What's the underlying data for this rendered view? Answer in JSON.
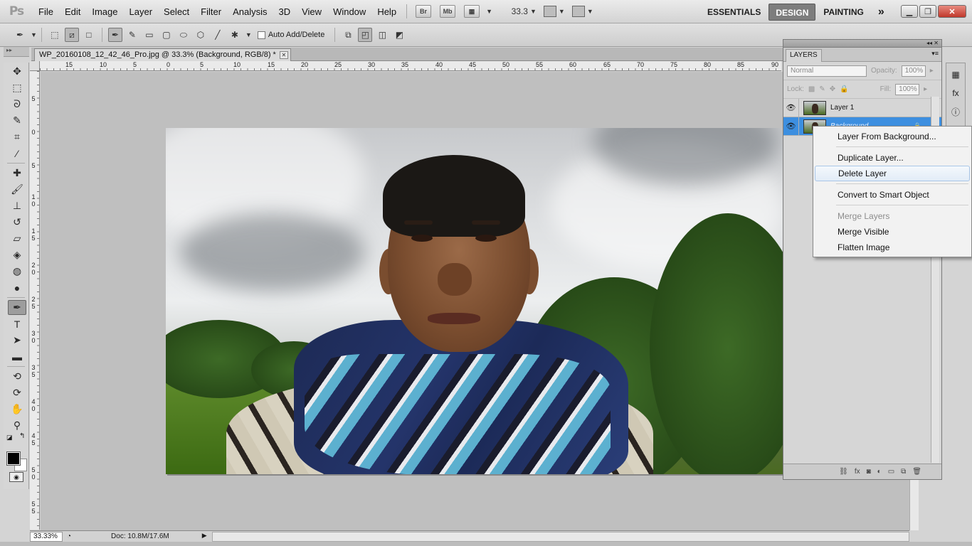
{
  "app": {
    "logo": "Ps"
  },
  "menubar": {
    "items": [
      "File",
      "Edit",
      "Image",
      "Layer",
      "Select",
      "Filter",
      "Analysis",
      "3D",
      "View",
      "Window",
      "Help"
    ],
    "bridge": "Br",
    "minibridge": "Mb",
    "zoom_value": "33.3",
    "workspaces": [
      "ESSENTIALS",
      "DESIGN",
      "PAINTING"
    ],
    "active_workspace": "DESIGN",
    "more": "»"
  },
  "optionsbar": {
    "auto_add_delete_label": "Auto Add/Delete"
  },
  "document": {
    "tab_title": "WP_20160108_12_42_46_Pro.jpg @ 33.3% (Background, RGB/8) *",
    "ruler_h_labels": [
      "15",
      "10",
      "5",
      "0",
      "5",
      "10",
      "15",
      "20",
      "25",
      "30",
      "35",
      "40",
      "45",
      "50",
      "55",
      "60",
      "65",
      "70",
      "75",
      "80",
      "85",
      "90"
    ],
    "ruler_v_labels": [
      "5",
      "0",
      "5",
      "1 0",
      "1 5",
      "2 0",
      "2 5",
      "3 0",
      "3 5",
      "4 0",
      "4 5",
      "5 0",
      "5 5"
    ]
  },
  "status": {
    "zoom": "33.33%",
    "doc_size": "Doc: 10.8M/17.6M"
  },
  "layers_panel": {
    "tab": "LAYERS",
    "blend_mode": "Normal",
    "opacity_label": "Opacity:",
    "opacity_value": "100%",
    "lock_label": "Lock:",
    "fill_label": "Fill:",
    "fill_value": "100%",
    "layers": [
      {
        "name": "Layer 1",
        "selected": false
      },
      {
        "name": "Background",
        "selected": true
      }
    ]
  },
  "context_menu": {
    "items": [
      {
        "label": "Layer From Background...",
        "disabled": false
      },
      {
        "label": "Duplicate Layer...",
        "disabled": false
      },
      {
        "label": "Delete Layer",
        "disabled": false,
        "hover": true
      },
      {
        "label": "Convert to Smart Object",
        "disabled": false
      },
      {
        "label": "Merge Layers",
        "disabled": true
      },
      {
        "label": "Merge Visible",
        "disabled": false
      },
      {
        "label": "Flatten Image",
        "disabled": false
      }
    ]
  },
  "colors": {
    "selection_blue": "#3d8fe0",
    "menu_hover_border": "#a9c6e8",
    "workspace_active_bg": "#7d7d7d"
  }
}
